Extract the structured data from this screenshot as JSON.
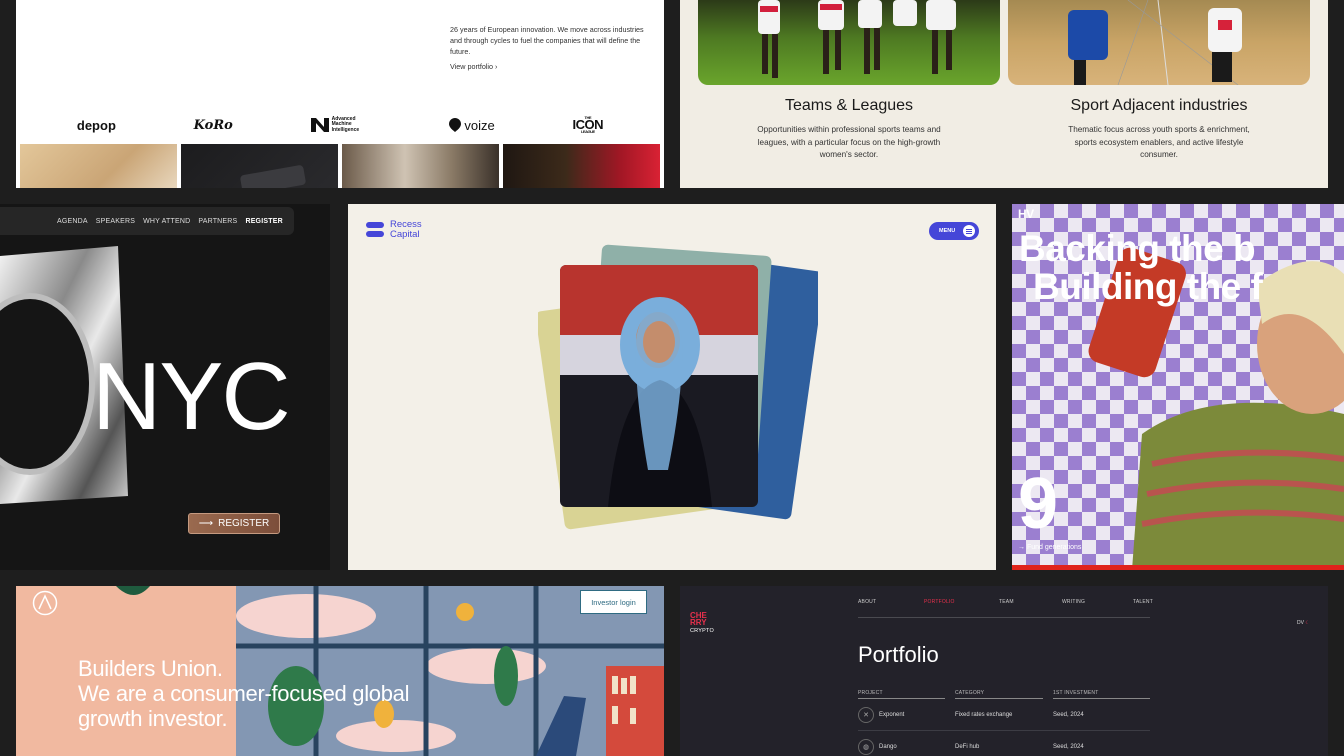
{
  "panel1": {
    "intro": "26 years of European innovation. We move across industries and through cycles to fuel the companies that will define the future.",
    "view_portfolio": "View portfolio",
    "logos": [
      "depop",
      "KoRo",
      "Advanced Machine Intelligence",
      "voize",
      "ICON",
      "THE",
      "LEAGUE"
    ]
  },
  "panel2": {
    "col1_title": "Teams & Leagues",
    "col1_desc": "Opportunities within professional sports teams and leagues, with a particular focus on the high-growth women's sector.",
    "col2_title": "Sport Adjacent industries",
    "col2_desc": "Thematic focus across youth sports & enrichment, sports ecosystem enablers, and active lifestyle consumer."
  },
  "panel3": {
    "nav": [
      "AGENDA",
      "SPEAKERS",
      "WHY ATTEND",
      "PARTNERS",
      "REGISTER"
    ],
    "city": "NYC",
    "register_button": "REGISTER"
  },
  "panel4": {
    "brand_line1": "Recess",
    "brand_line2": "Capital",
    "menu": "MENU"
  },
  "panel5": {
    "logo": "HV",
    "headline_line1": "Backing the b",
    "headline_line2": "Building the f",
    "number": "9",
    "fund_label": "Fund generations"
  },
  "panel6": {
    "title": "Builders Union.",
    "subtitle": "We are a consumer-focused global growth investor.",
    "login": "Investor login"
  },
  "panel7": {
    "logo_line1": "CHE",
    "logo_line2": "RRY",
    "logo_sub": "CRYPTO",
    "nav": [
      "ABOUT",
      "PORTFOLIO",
      "TEAM",
      "WRITING",
      "TALENT"
    ],
    "dv": "DV",
    "heading": "Portfolio",
    "columns": [
      "PROJECT",
      "CATEGORY",
      "1ST INVESTMENT"
    ],
    "rows": [
      {
        "project": "Exponent",
        "category": "Fixed rates exchange",
        "investment": "Seed, 2024"
      },
      {
        "project": "Dango",
        "category": "DeFi hub",
        "investment": "Seed, 2024"
      }
    ]
  }
}
